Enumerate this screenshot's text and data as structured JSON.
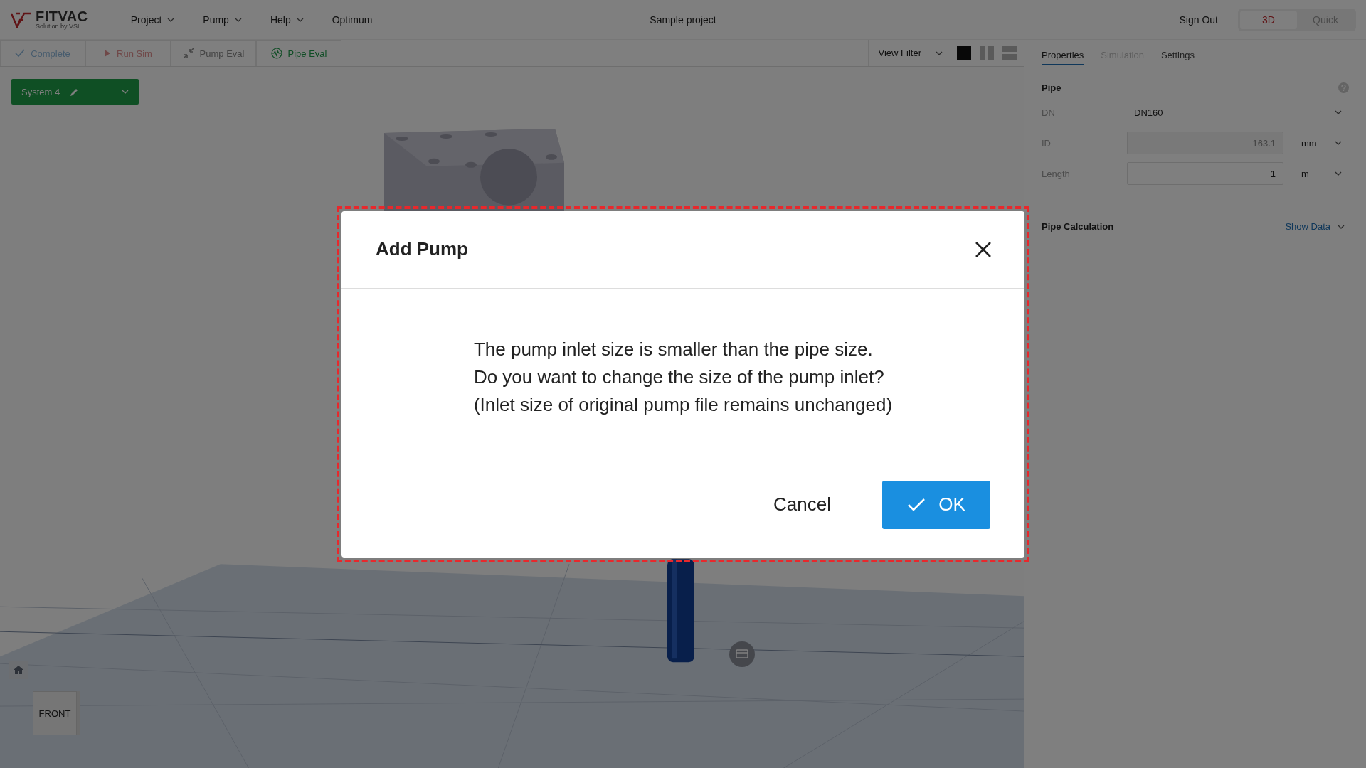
{
  "app": {
    "logo_text": "FITVAC",
    "logo_tagline": "Solution by VSL",
    "project_title": "Sample project",
    "sign_out": "Sign Out"
  },
  "menu": [
    {
      "label": "Project",
      "has_dropdown": true
    },
    {
      "label": "Pump",
      "has_dropdown": true
    },
    {
      "label": "Help",
      "has_dropdown": true
    },
    {
      "label": "Optimum",
      "has_dropdown": false
    }
  ],
  "mode_toggle": [
    {
      "label": "3D",
      "selected": true
    },
    {
      "label": "Quick",
      "selected": false
    }
  ],
  "toolbar": [
    {
      "kind": "check",
      "label": "Complete"
    },
    {
      "kind": "play",
      "label": "Run Sim"
    },
    {
      "kind": "compress",
      "label": "Pump Eval"
    },
    {
      "kind": "wave",
      "label": "Pipe Eval"
    }
  ],
  "view_filter": {
    "label": "View Filter",
    "layouts": [
      {
        "kind": "single",
        "selected": true
      },
      {
        "kind": "columns",
        "selected": false
      },
      {
        "kind": "rows",
        "selected": false
      }
    ]
  },
  "system_selector": {
    "label": "System 4"
  },
  "viewport": {
    "cube_label": "FRONT"
  },
  "panel": {
    "tabs": [
      {
        "label": "Properties",
        "selected": true,
        "disabled": false
      },
      {
        "label": "Simulation",
        "selected": false,
        "disabled": true
      },
      {
        "label": "Settings",
        "selected": false,
        "disabled": false
      }
    ],
    "section_title": "Pipe",
    "fields": [
      {
        "kind": "select",
        "label": "DN",
        "value": "DN160"
      },
      {
        "kind": "number",
        "label": "ID",
        "value": "163.1",
        "unit": "mm",
        "disabled": true
      },
      {
        "kind": "number",
        "label": "Length",
        "value": "1",
        "unit": "m",
        "disabled": false
      }
    ],
    "calculation": {
      "title": "Pipe Calculation",
      "action": "Show Data"
    }
  },
  "dialog": {
    "title": "Add Pump",
    "message": [
      "The pump inlet size is smaller than the pipe size.",
      "Do you want to change the size of the pump inlet?",
      "(Inlet size of original pump file remains unchanged)"
    ],
    "buttons": [
      {
        "kind": "secondary",
        "label": "Cancel"
      },
      {
        "kind": "primary",
        "label": "OK"
      }
    ]
  }
}
